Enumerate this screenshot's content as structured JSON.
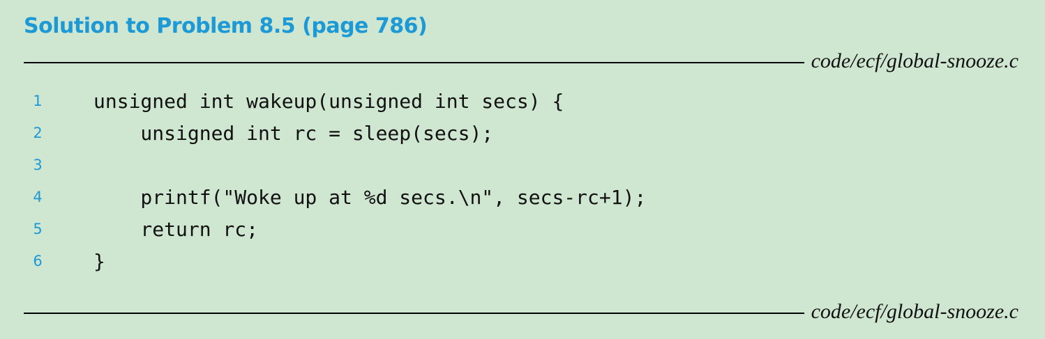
{
  "heading": {
    "title": "Solution to Problem 8.5",
    "page_ref": "(page 786)"
  },
  "source_file": {
    "top_label": "code/ecf/global-snooze.c",
    "bottom_label": "code/ecf/global-snooze.c"
  },
  "code": {
    "lines": [
      {
        "number": "1",
        "text": "unsigned int wakeup(unsigned int secs) {"
      },
      {
        "number": "2",
        "text": "    unsigned int rc = sleep(secs);"
      },
      {
        "number": "3",
        "text": ""
      },
      {
        "number": "4",
        "text": "    printf(\"Woke up at %d secs.\\n\", secs-rc+1);"
      },
      {
        "number": "5",
        "text": "    return rc;"
      },
      {
        "number": "6",
        "text": "}"
      }
    ]
  },
  "colors": {
    "background": "#cfe6d1",
    "accent": "#1d9ad6",
    "text": "#111111"
  }
}
